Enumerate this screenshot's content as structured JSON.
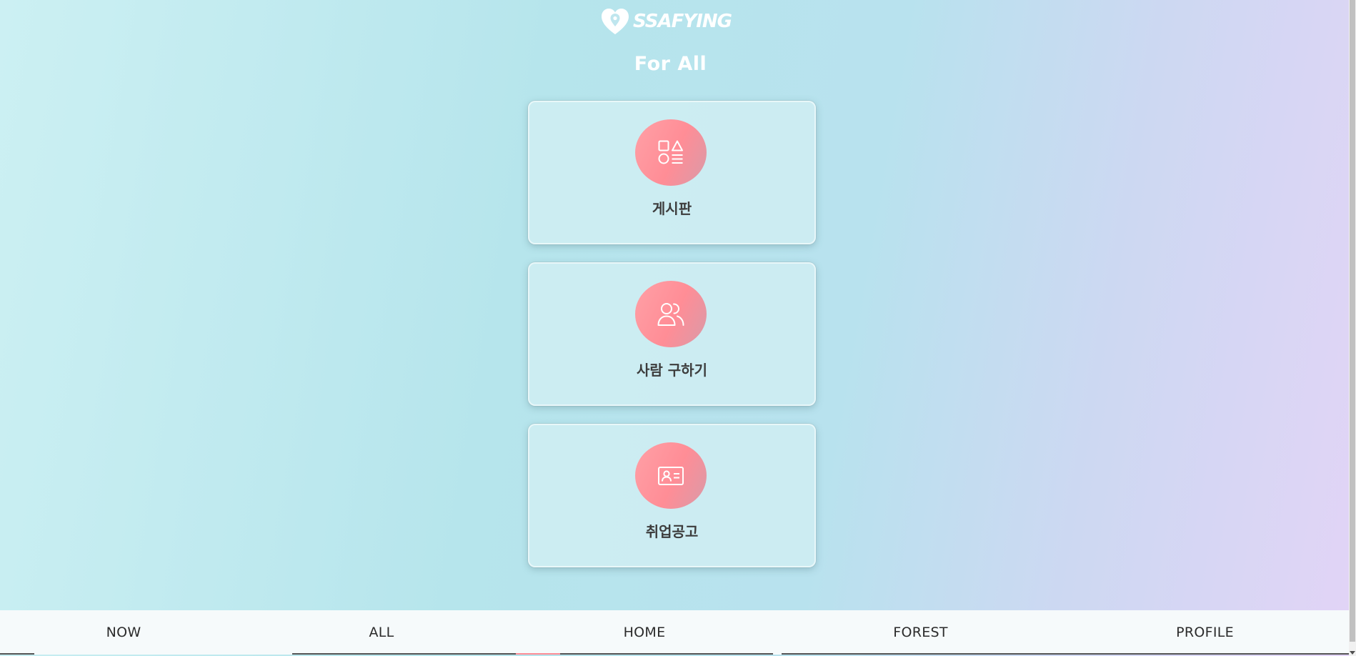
{
  "header": {
    "brand_name": "SSAFYING",
    "brand_icon": "heart-pin-icon",
    "title": "For All"
  },
  "cards": [
    {
      "label": "게시판",
      "icon": "board-shapes-icon"
    },
    {
      "label": "사람 구하기",
      "icon": "people-icon"
    },
    {
      "label": "취업공고",
      "icon": "id-card-icon"
    }
  ],
  "bottom_nav": {
    "items": [
      {
        "label": "NOW"
      },
      {
        "label": "ALL"
      },
      {
        "label": "HOME"
      },
      {
        "label": "FOREST"
      },
      {
        "label": "PROFILE"
      }
    ]
  },
  "colors": {
    "accent_pink": "#ff8d96",
    "title_white": "#ffffff",
    "nav_background": "#f6fafb"
  }
}
